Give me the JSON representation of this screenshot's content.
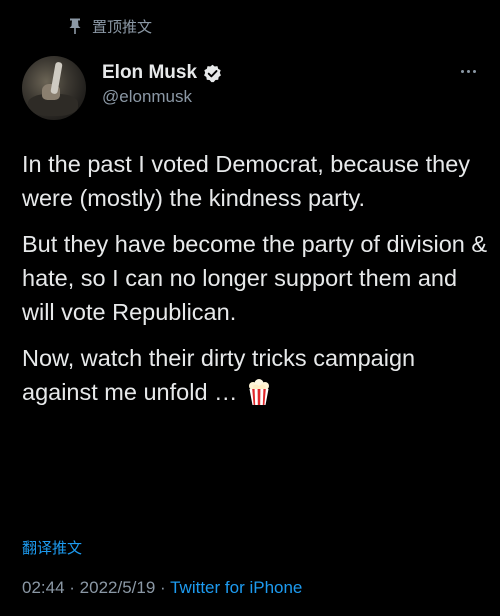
{
  "pinned": {
    "label": "置顶推文",
    "icon": "pin-icon"
  },
  "author": {
    "display_name": "Elon Musk",
    "handle": "@elonmusk",
    "verified": true,
    "avatar_icon": "avatar"
  },
  "tweet": {
    "paragraphs": [
      "In the past I voted Democrat, because they were (mostly) the kindness party.",
      "But they have become the party of division & hate, so I can no longer support them and will vote Republican.",
      "Now, watch their dirty tricks campaign against me unfold …"
    ],
    "emoji_icon": "popcorn-icon"
  },
  "translate_label": "翻译推文",
  "meta": {
    "time": "02:44",
    "date": "2022/5/19",
    "separator": " · ",
    "source": "Twitter for iPhone"
  },
  "colors": {
    "background": "#000000",
    "text": "#e7e9ea",
    "secondary": "#8b98a5",
    "accent": "#1d9bf0"
  }
}
